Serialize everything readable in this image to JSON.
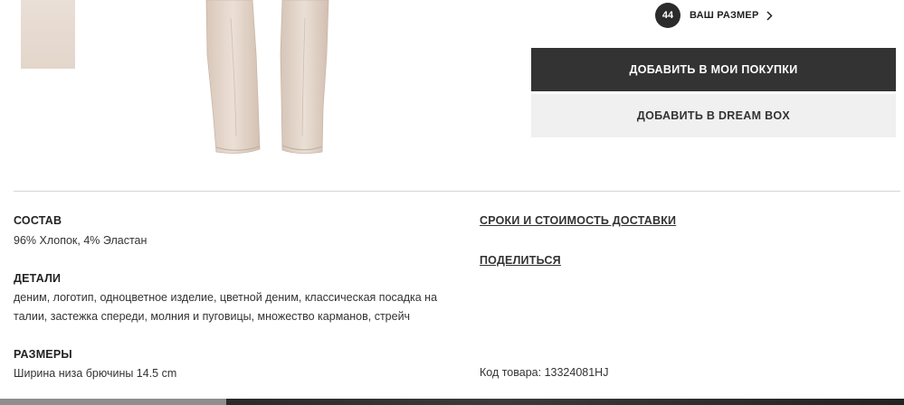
{
  "size": {
    "value": "44",
    "label": "ВАШ РАЗМЕР"
  },
  "actions": {
    "add_to_cart": "ДОБАВИТЬ В МОИ ПОКУПКИ",
    "add_to_dream_box": "ДОБАВИТЬ В DREAM BOX"
  },
  "composition": {
    "title": "СОСТАВ",
    "text": "96% Хлопок, 4% Эластан"
  },
  "details": {
    "title": "ДЕТАЛИ",
    "line1": "деним, логотип, одноцветное изделие, цветной деним, классическая посадка на",
    "line2": "талии, застежка спереди, молния и пуговицы, множество карманов, стрейч"
  },
  "sizes": {
    "title": "РАЗМЕРЫ",
    "text": "Ширина низа брючины 14.5 cm"
  },
  "links": {
    "delivery": "СРОКИ И СТОИМОСТЬ ДОСТАВКИ",
    "share": "ПОДЕЛИТЬСЯ"
  },
  "product_code": "Код товара: 13324081HJ",
  "colors": {
    "dark_button": "#333333",
    "light_button": "#f0f0f0",
    "fabric": "#e6d8cc"
  }
}
